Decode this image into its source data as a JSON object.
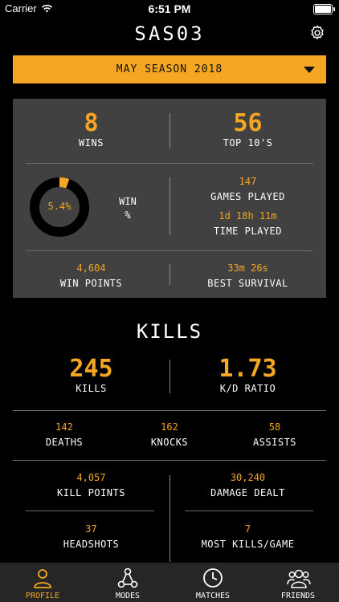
{
  "status_bar": {
    "carrier": "Carrier",
    "time": "6:51 PM"
  },
  "header": {
    "title": "SAS03"
  },
  "season": {
    "label": "MAY SEASON 2018"
  },
  "overview": {
    "wins": {
      "value": "8",
      "label": "WINS"
    },
    "top10": {
      "value": "56",
      "label": "TOP 10'S"
    },
    "win_percent": {
      "value": "5.4%",
      "label_line1": "WIN",
      "label_line2": "%",
      "fraction": 0.054
    },
    "games_played": {
      "value": "147",
      "label": "GAMES PLAYED"
    },
    "time_played": {
      "value": "1d 18h 11m",
      "label": "TIME PLAYED"
    },
    "win_points": {
      "value": "4,604",
      "label": "WIN POINTS"
    },
    "best_survival": {
      "value": "33m 26s",
      "label": "BEST SURVIVAL"
    }
  },
  "kills": {
    "heading": "KILLS",
    "kills": {
      "value": "245",
      "label": "KILLS"
    },
    "kd_ratio": {
      "value": "1.73",
      "label": "K/D RATIO"
    },
    "deaths": {
      "value": "142",
      "label": "DEATHS"
    },
    "knocks": {
      "value": "162",
      "label": "KNOCKS"
    },
    "assists": {
      "value": "58",
      "label": "ASSISTS"
    },
    "kill_points": {
      "value": "4,057",
      "label": "KILL POINTS"
    },
    "damage_dealt": {
      "value": "30,240",
      "label": "DAMAGE DEALT"
    },
    "headshots": {
      "value": "37",
      "label": "HEADSHOTS"
    },
    "most_kills_game": {
      "value": "7",
      "label": "MOST KILLS/GAME"
    }
  },
  "tabs": [
    {
      "label": "PROFILE",
      "icon": "person-icon",
      "active": true
    },
    {
      "label": "MODES",
      "icon": "nodes-icon",
      "active": false
    },
    {
      "label": "MATCHES",
      "icon": "clock-icon",
      "active": false
    },
    {
      "label": "FRIENDS",
      "icon": "group-icon",
      "active": false
    }
  ],
  "colors": {
    "accent": "#f5a623",
    "panel": "#414141",
    "background": "#000000",
    "tabbar": "#262626"
  }
}
